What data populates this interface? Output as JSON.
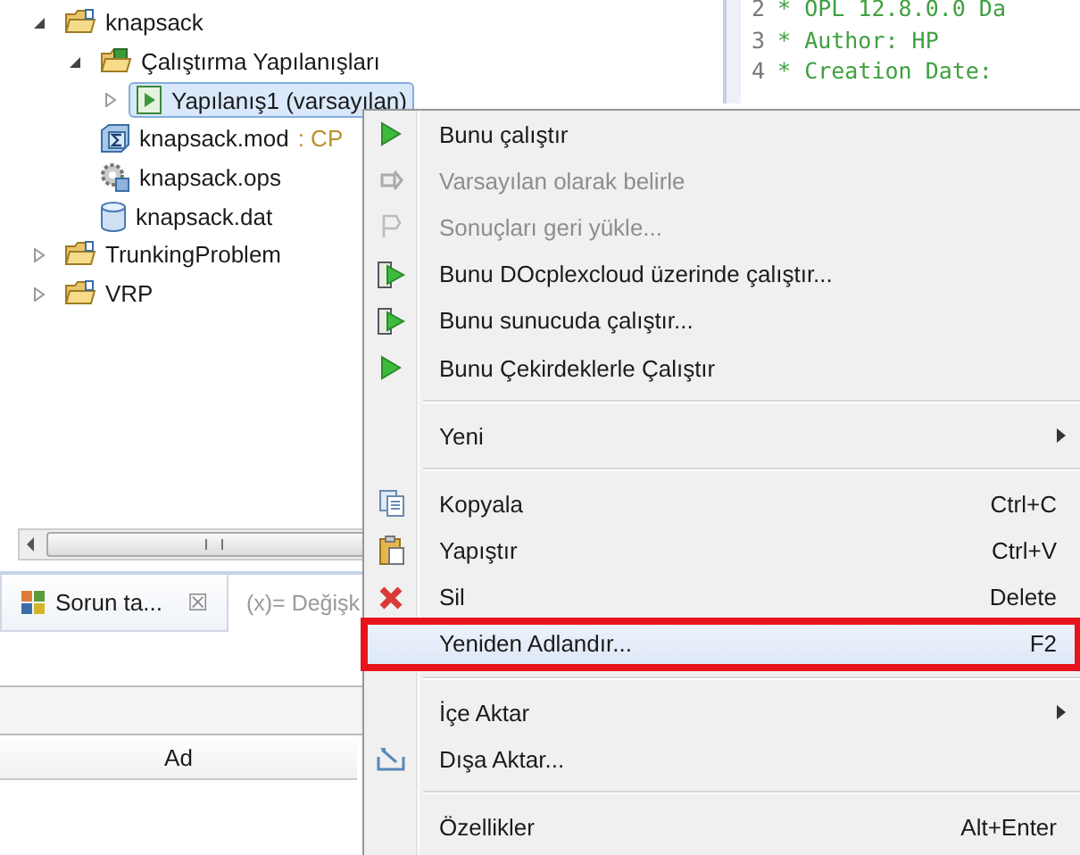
{
  "tree": [
    {
      "label": "knapsack",
      "kind": "project",
      "expanded": true,
      "children": [
        {
          "label": "Çalıştırma Yapılanışları",
          "kind": "run-configs",
          "expanded": true,
          "children": [
            {
              "label": "Yapılanış1 (varsayılan)",
              "kind": "run-config",
              "expanded": false,
              "selected": true
            }
          ]
        },
        {
          "label": "knapsack.mod",
          "suffix": ": CP",
          "kind": "model",
          "selected": false
        },
        {
          "label": "knapsack.ops",
          "kind": "settings",
          "selected": false
        },
        {
          "label": "knapsack.dat",
          "kind": "data",
          "selected": false
        }
      ]
    },
    {
      "label": "TrunkingProblem",
      "kind": "project",
      "expanded": false
    },
    {
      "label": "VRP",
      "kind": "project",
      "expanded": false
    }
  ],
  "editor": {
    "lines": [
      {
        "number": "2",
        "text": "* OPL 12.8.0.0 Da"
      },
      {
        "number": "3",
        "text": "* Author: HP"
      },
      {
        "number": "4",
        "text": "* Creation Date:"
      }
    ]
  },
  "bottom_panel": {
    "tabs": [
      {
        "label": "Sorun ta...",
        "close": "☒",
        "selected": true
      },
      {
        "label": "(x)= Değişk",
        "selected": false
      }
    ],
    "column_header": "Ad"
  },
  "context_menu": {
    "items": [
      {
        "kind": "run",
        "label": "Bunu çalıştır",
        "disabled": false,
        "selected": false
      },
      {
        "kind": "set-default",
        "label": "Varsayılan olarak belirle",
        "disabled": true,
        "selected": false
      },
      {
        "kind": "restore",
        "label": "Sonuçları geri yükle...",
        "disabled": true,
        "selected": false
      },
      {
        "kind": "server-run",
        "label": "Bunu DOcplexcloud üzerinde çalıştır...",
        "disabled": false,
        "selected": false
      },
      {
        "kind": "server-run",
        "label": "Bunu sunucuda çalıştır...",
        "disabled": false,
        "selected": false
      },
      {
        "kind": "run",
        "label": "Bunu Çekirdeklerle Çalıştır",
        "disabled": false,
        "selected": false
      },
      {
        "kind": "separator"
      },
      {
        "kind": "plain",
        "label": "Yeni",
        "submenu": true,
        "disabled": false,
        "selected": false
      },
      {
        "kind": "separator"
      },
      {
        "kind": "copy",
        "label": "Kopyala",
        "shortcut": "Ctrl+C",
        "disabled": false,
        "selected": false
      },
      {
        "kind": "paste",
        "label": "Yapıştır",
        "shortcut": "Ctrl+V",
        "disabled": false,
        "selected": false
      },
      {
        "kind": "delete",
        "label": "Sil",
        "shortcut": "Delete",
        "disabled": false,
        "selected": false
      },
      {
        "kind": "plain",
        "label": "Yeniden Adlandır...",
        "shortcut": "F2",
        "disabled": false,
        "selected": true,
        "annotated": true
      },
      {
        "kind": "separator"
      },
      {
        "kind": "plain",
        "label": "İçe Aktar",
        "submenu": true,
        "disabled": false,
        "selected": false
      },
      {
        "kind": "export",
        "label": "Dışa Aktar...",
        "disabled": false,
        "selected": false
      },
      {
        "kind": "separator"
      },
      {
        "kind": "plain",
        "label": "Özellikler",
        "shortcut": "Alt+Enter",
        "disabled": false,
        "selected": false
      }
    ]
  }
}
